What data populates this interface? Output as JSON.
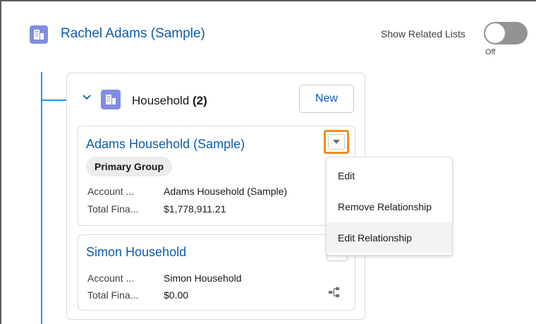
{
  "header": {
    "title": "Rachel Adams (Sample)",
    "icon": "account-icon"
  },
  "toggle": {
    "label": "Show Related Lists",
    "state": "Off",
    "on": false
  },
  "group": {
    "title": "Household",
    "count": "(2)",
    "new_label": "New",
    "icon": "household-icon"
  },
  "records": [
    {
      "title": "Adams Household (Sample)",
      "badge": "Primary Group",
      "fields": [
        {
          "label": "Account ...",
          "value": "Adams Household (Sample)"
        },
        {
          "label": "Total Fina...",
          "value": "$1,778,911.21"
        }
      ]
    },
    {
      "title": "Simon Household",
      "fields": [
        {
          "label": "Account ...",
          "value": "Simon Household"
        },
        {
          "label": "Total Fina...",
          "value": "$0.00"
        }
      ]
    }
  ],
  "menu": {
    "items": [
      {
        "label": "Edit"
      },
      {
        "label": "Remove Relationship"
      },
      {
        "label": "Edit Relationship"
      }
    ],
    "active_index": 2
  },
  "colors": {
    "link": "#0b5cab",
    "tree_line": "#1b96ff",
    "icon_bg": "#7f8de1",
    "highlight": "#ee8b22"
  }
}
